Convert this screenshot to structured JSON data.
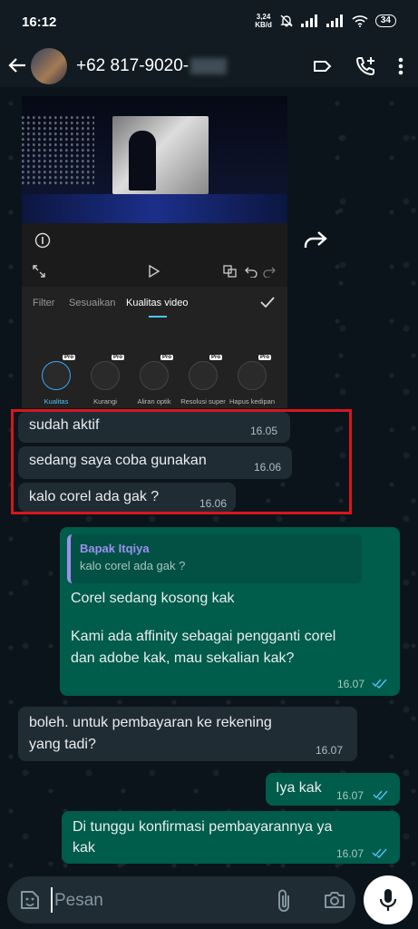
{
  "status_bar": {
    "time": "16:12",
    "net_speed_value": "3,24",
    "net_speed_unit": "KB/d",
    "battery": "34"
  },
  "header": {
    "contact_number": "+62 817-9020-"
  },
  "media_preview": {
    "tabs": [
      "Filter",
      "Sesuaikan",
      "Kualitas video"
    ],
    "tools": [
      {
        "label": "Kualitas",
        "badge": "Pro"
      },
      {
        "label": "Kurangi",
        "badge": "Pro"
      },
      {
        "label": "Aliran optik",
        "badge": "Pro"
      },
      {
        "label": "Resolusi super",
        "badge": "Pro"
      },
      {
        "label": "Hapus kedipan",
        "badge": "Pro"
      }
    ]
  },
  "messages": [
    {
      "direction": "in",
      "text": "sudah aktif",
      "time": "16.05"
    },
    {
      "direction": "in",
      "text": "sedang saya coba gunakan",
      "time": "16.06"
    },
    {
      "direction": "in",
      "text": "kalo corel ada gak ?",
      "time": "16.06"
    },
    {
      "direction": "out",
      "quote_name": "Bapak Itqiya",
      "quote_text": "kalo corel ada gak ?",
      "text_line1": "Corel sedang kosong kak",
      "text_line2": "Kami ada affinity sebagai pengganti corel",
      "text_line3": "dan adobe kak, mau sekalian kak?",
      "time": "16.07"
    },
    {
      "direction": "in",
      "text_line1": "boleh. untuk pembayaran ke rekening",
      "text_line2": "yang tadi?",
      "time": "16.07"
    },
    {
      "direction": "out",
      "text": "Iya kak",
      "time": "16.07"
    },
    {
      "direction": "out",
      "text_line1": "Di tunggu konfirmasi pembayarannya ya",
      "text_line2": "kak",
      "time": "16.07"
    }
  ],
  "composer": {
    "placeholder": "Pesan"
  },
  "colors": {
    "incoming_bubble": "#202c33",
    "outgoing_bubble": "#005c4b",
    "highlight_box": "#d8161f",
    "read_ticks": "#53bdeb"
  }
}
